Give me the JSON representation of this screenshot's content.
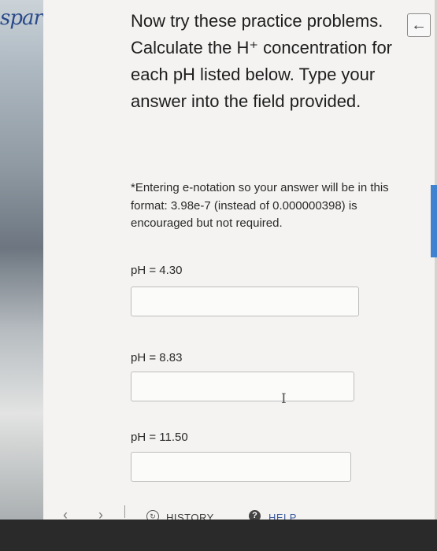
{
  "sidebar": {
    "logo": "spark"
  },
  "header": {
    "back_icon": "arrow-left-icon"
  },
  "main": {
    "intro": "Now try these practice problems. Calculate the H⁺ concentration for each pH listed below. Type your answer into the field provided.",
    "note": "*Entering e-notation so your answer will be in this format: 3.98e-7 (instead of 0.000000398) is encouraged but not required.",
    "problems": [
      {
        "label": "pH = 4.30",
        "value": "",
        "placeholder": ""
      },
      {
        "label": "pH = 8.83",
        "value": "",
        "placeholder": ""
      },
      {
        "label": "pH = 11.50",
        "value": "",
        "placeholder": ""
      }
    ]
  },
  "footer": {
    "prev_icon": "‹",
    "next_icon": "›",
    "history_label": "HISTORY",
    "help_label": "HELP"
  },
  "colors": {
    "accent": "#3f83d0",
    "page_bg": "#f4f3f1"
  }
}
